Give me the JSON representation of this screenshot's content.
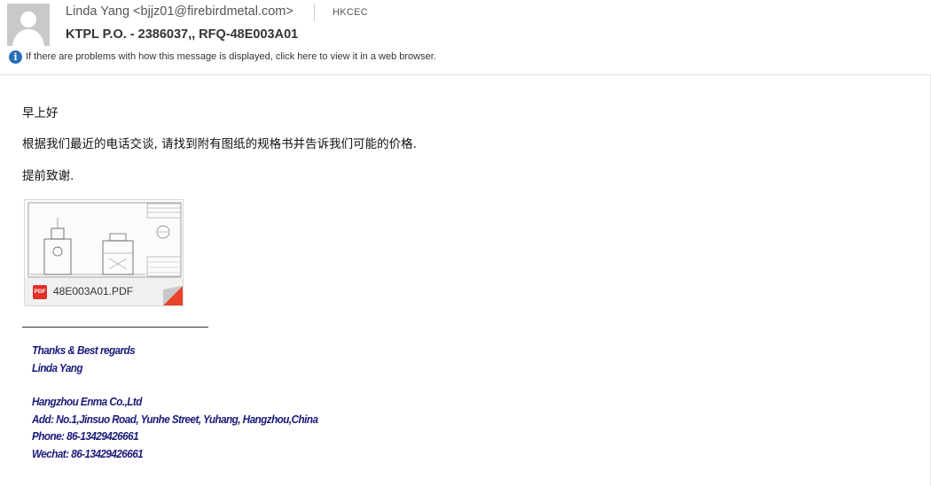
{
  "message": {
    "sender": "Linda Yang <bjjz01@firebirdmetal.com>",
    "recipient": "HKCEC",
    "subject": "KTPL P.O. - 2386037,, RFQ-48E003A01",
    "info_bar": "If there are problems with how this message is displayed, click here to view it in a web browser."
  },
  "body": {
    "greeting": "早上好",
    "line1": "根据我们最近的电话交谈, 请找到附有图纸的规格书并告诉我们可能的价格.",
    "line2": "提前致谢."
  },
  "attachment": {
    "file_name": "48E003A01.PDF",
    "type_label": "PDF"
  },
  "signature": {
    "closing": "Thanks & Best regards",
    "name": "Linda Yang",
    "company": "Hangzhou Enma Co.,Ltd",
    "address": "Add: No.1,Jinsuo Road, Yunhe Street, Yuhang, Hangzhou,China",
    "phone": "Phone: 86-13429426661",
    "wechat": "Wechat: 86-13429426661"
  },
  "colors": {
    "info_icon": "#2a6ebb",
    "pdf_badge": "#e0302a",
    "signature_text": "#1a1a7a"
  }
}
